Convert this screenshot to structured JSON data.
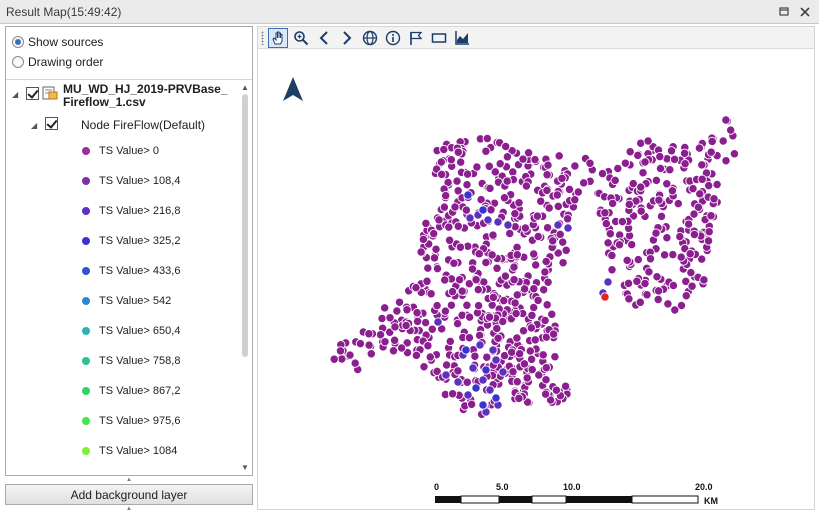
{
  "window": {
    "title": "Result Map(15:49:42)",
    "pin_icon": "pin-icon",
    "close_icon": "close-icon"
  },
  "sources_panel": {
    "view_options": [
      {
        "label": "Show sources",
        "checked": true
      },
      {
        "label": "Drawing order",
        "checked": false
      }
    ],
    "layer": {
      "file_name": "MU_WD_HJ_2019-PRVBase_Fireflow_1.csv",
      "checked": true,
      "node_group": {
        "label": "Node FireFlow(Default)",
        "checked": true,
        "legend": [
          {
            "label": "TS Value> 0",
            "color": "#9b2e9b"
          },
          {
            "label": "TS Value> 108,4",
            "color": "#7c2fa8"
          },
          {
            "label": "TS Value> 216,8",
            "color": "#5a32bf"
          },
          {
            "label": "TS Value> 325,2",
            "color": "#3b33d0"
          },
          {
            "label": "TS Value> 433,6",
            "color": "#2f54d4"
          },
          {
            "label": "TS Value> 542",
            "color": "#2e84cf"
          },
          {
            "label": "TS Value> 650,4",
            "color": "#2bb3b3"
          },
          {
            "label": "TS Value> 758,8",
            "color": "#2cc48a"
          },
          {
            "label": "TS Value> 867,2",
            "color": "#2fd35e"
          },
          {
            "label": "TS Value> 975,6",
            "color": "#3ee84a"
          },
          {
            "label": "TS Value> 1084",
            "color": "#7ff035"
          }
        ]
      }
    },
    "add_background_label": "Add background layer"
  },
  "map_toolbar": {
    "tools": [
      {
        "name": "pan-hand-icon",
        "active": true
      },
      {
        "name": "zoom-icon",
        "active": false
      },
      {
        "name": "previous-extent-icon",
        "active": false
      },
      {
        "name": "next-extent-icon",
        "active": false
      },
      {
        "name": "globe-icon",
        "active": false
      },
      {
        "name": "info-icon",
        "active": false
      },
      {
        "name": "flag-icon",
        "active": false
      },
      {
        "name": "rectangle-icon",
        "active": false
      },
      {
        "name": "chart-icon",
        "active": false
      }
    ]
  },
  "map": {
    "north_arrow_icon": "north-arrow-icon",
    "node_color": "#8b1f8f",
    "node_color_mid": "#5a32bf",
    "node_color_high": "#3b33d0",
    "highlight_color": "#e8231e",
    "scale_bar": {
      "ticks": [
        "0",
        "5.0",
        "10.0",
        "20.0"
      ],
      "unit": "KM"
    }
  }
}
